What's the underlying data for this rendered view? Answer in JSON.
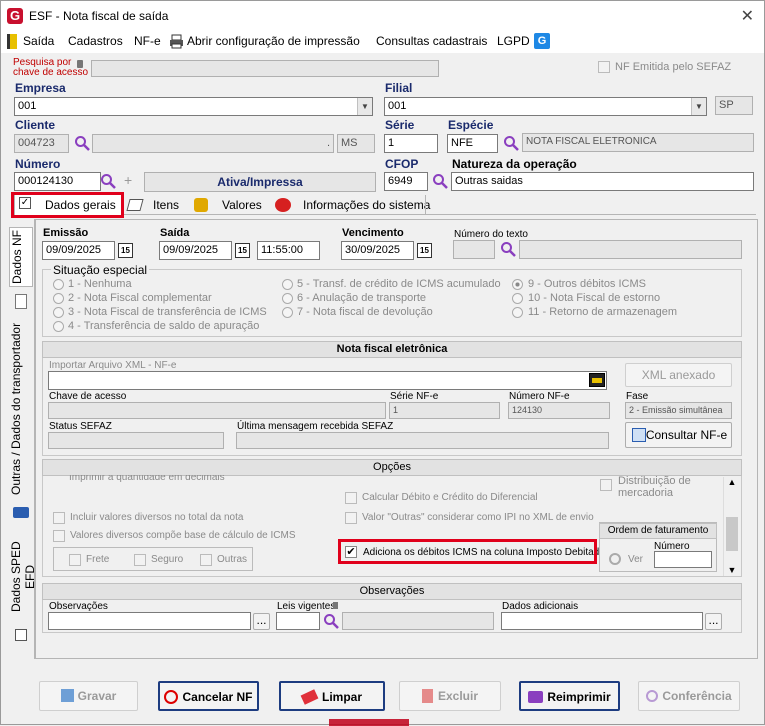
{
  "window": {
    "title": "ESF - Nota fiscal de saída",
    "logo_letter": "G",
    "close_glyph": "✕"
  },
  "menu": {
    "items": [
      "Saída",
      "Cadastros",
      "NF-e",
      "Abrir configuração de impressão",
      "Consultas cadastrais",
      "LGPD"
    ]
  },
  "header": {
    "search_label_line1": "Pesquisa por",
    "search_label_line2": "chave de acesso",
    "nf_emitida_label": "NF Emitida pelo SEFAZ",
    "empresa_label": "Empresa",
    "empresa_value": "001",
    "filial_label": "Filial",
    "filial_value": "001",
    "filial_uf": "SP",
    "cliente_label": "Cliente",
    "cliente_value": "004723",
    "cliente_uf": "MS",
    "cliente_dot": ".",
    "serie_label": "Série",
    "serie_value": "1",
    "especie_label": "Espécie",
    "especie_value": "NFE",
    "especie_desc": "NOTA FISCAL ELETRONICA",
    "numero_label": "Número",
    "numero_value": "000124130",
    "status": "Ativa/Impressa",
    "cfop_label": "CFOP",
    "cfop_value": "6949",
    "natureza_label": "Natureza da operação",
    "natureza_value": "Outras saidas"
  },
  "tabs": [
    "Dados gerais",
    "Itens",
    "Valores",
    "Informações do sistema"
  ],
  "side_tabs": [
    "Dados NF",
    "Outras / Dados do transportador",
    "Dados SPED EFD"
  ],
  "dados": {
    "emissao_label": "Emissão",
    "emissao_value": "09/09/2025",
    "saida_label": "Saída",
    "saida_value": "09/09/2025",
    "saida_hora": "11:55:00",
    "vencimento_label": "Vencimento",
    "vencimento_value": "30/09/2025",
    "numero_texto_label": "Número do texto",
    "cal_glyph": "15",
    "situacao_title": "Situação especial",
    "situacao_col1": [
      "1 - Nenhuma",
      "2 - Nota Fiscal complementar",
      "3 - Nota Fiscal de transferência de ICMS",
      "4 - Transferência de saldo de apuração"
    ],
    "situacao_col2": [
      "5 - Transf. de crédito de ICMS acumulado",
      "6 - Anulação de transporte",
      "7 - Nota fiscal de devolução"
    ],
    "situacao_col3": [
      "9 - Outros débitos ICMS",
      "10 - Nota Fiscal de estorno",
      "11 - Retorno de armazenagem"
    ]
  },
  "nfe": {
    "title": "Nota fiscal eletrônica",
    "importar_label": "Importar Arquivo XML - NF-e",
    "xml_anexado_btn": "XML anexado",
    "chave_label": "Chave de acesso",
    "serie_label": "Série NF-e",
    "serie_value": "1",
    "numero_label": "Número NF-e",
    "numero_value": "124130",
    "fase_label": "Fase",
    "fase_value": "2 - Emissão simultânea",
    "status_label": "Status SEFAZ",
    "ultima_label": "Última mensagem recebida SEFAZ",
    "consultar_btn": "Consultar NF-e"
  },
  "opcoes": {
    "title": "Opções",
    "imprimir_label": "Imprimir a quantidade em decimais",
    "distribuicao_label": "Distribuição de mercadoria",
    "calcular_label": "Calcular Débito e Crédito do Diferencial",
    "incluir_label": "Incluir valores diversos no total da nota",
    "valor_outras_label": "Valor \"Outras\" considerar como IPI no XML de envio",
    "valores_diversos_label": "Valores diversos compõe base de cálculo de ICMS",
    "frete_label": "Frete",
    "seguro_label": "Seguro",
    "outras_label": "Outras",
    "adiciona_label": "Adiciona os débitos ICMS na coluna Imposto Debitado",
    "ordem_title": "Ordem de faturamento",
    "ordem_numero_label": "Número",
    "ver_label": "Ver"
  },
  "observacoes": {
    "title": "Observações",
    "obs_label": "Observações",
    "leis_label": "Leis vigentes",
    "adicionais_label": "Dados adicionais",
    "ellipsis": "..."
  },
  "buttons": {
    "gravar": "Gravar",
    "cancelar": "Cancelar NF",
    "limpar": "Limpar",
    "excluir": "Excluir",
    "reimprimir": "Reimprimir",
    "conferencia": "Conferência"
  }
}
